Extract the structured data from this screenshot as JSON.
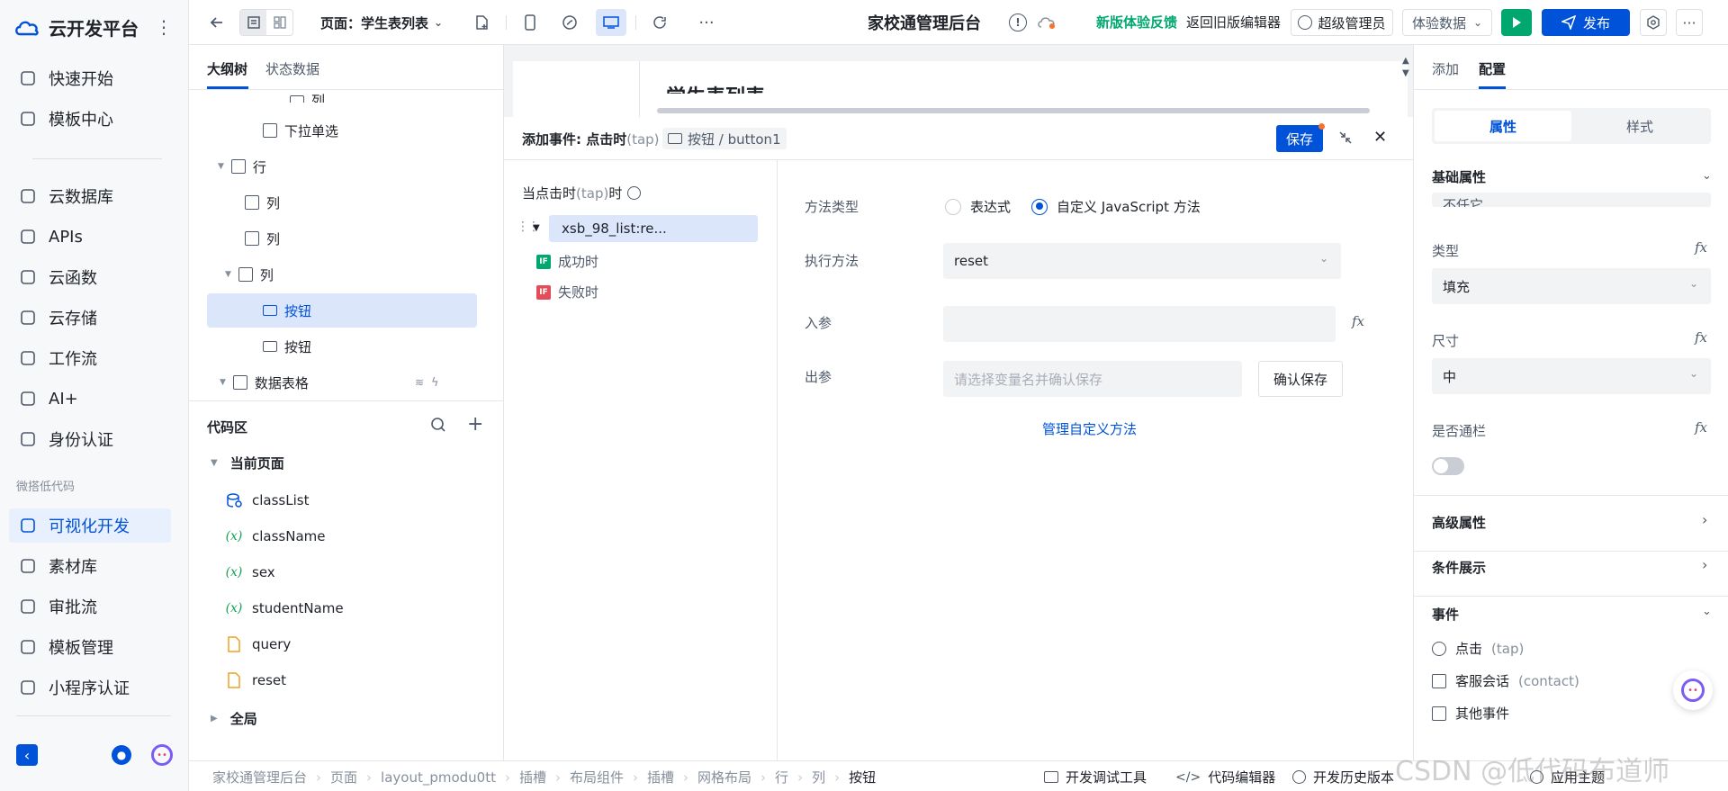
{
  "sidebar": {
    "brand": "云开发平台",
    "items_top": [
      {
        "label": "快速开始",
        "icon": "flag-icon"
      },
      {
        "label": "模板中心",
        "icon": "template-icon"
      }
    ],
    "items_mid": [
      {
        "label": "云数据库",
        "icon": "database-icon"
      },
      {
        "label": "APIs",
        "icon": "link-icon"
      },
      {
        "label": "云函数",
        "icon": "function-icon"
      },
      {
        "label": "云存储",
        "icon": "folder-icon"
      },
      {
        "label": "工作流",
        "icon": "workflow-icon"
      },
      {
        "label": "AI+",
        "icon": "robot-icon"
      },
      {
        "label": "身份认证",
        "icon": "id-card-icon"
      }
    ],
    "group_label": "微搭低代码",
    "items_low": [
      {
        "label": "可视化开发",
        "icon": "visual-dev-icon",
        "active": true
      },
      {
        "label": "素材库",
        "icon": "material-icon"
      },
      {
        "label": "审批流",
        "icon": "stamp-icon"
      },
      {
        "label": "模板管理",
        "icon": "template-manage-icon"
      },
      {
        "label": "小程序认证",
        "icon": "miniprogram-icon"
      }
    ]
  },
  "topbar": {
    "page_label": "页面：学生表列表",
    "app_title": "家校通管理后台",
    "feedback": "新版体验反馈",
    "back_old": "返回旧版编辑器",
    "user": "超级管理员",
    "data_mode": "体验数据",
    "publish": "发布"
  },
  "outline": {
    "tabs": [
      "大纲树",
      "状态数据"
    ],
    "rows": [
      {
        "label": "下拉单选",
        "indent": 82,
        "icon": "list-icon"
      },
      {
        "label": "行",
        "indent": 46,
        "icon": "box-icon",
        "caret": true
      },
      {
        "label": "列",
        "indent": 62,
        "icon": "box-icon"
      },
      {
        "label": "列",
        "indent": 62,
        "icon": "box-icon"
      },
      {
        "label": "列",
        "indent": 54,
        "icon": "box-icon",
        "caret": true
      },
      {
        "label": "按钮",
        "indent": 82,
        "icon": "button-icon",
        "selected": true
      },
      {
        "label": "按钮",
        "indent": 82,
        "icon": "button-icon"
      },
      {
        "label": "数据表格",
        "indent": 48,
        "icon": "table-icon",
        "caret": true
      }
    ],
    "partial_top": "列"
  },
  "code": {
    "title": "代码区",
    "current_page": "当前页面",
    "global": "全局",
    "items": [
      {
        "label": "classList",
        "kind": "query"
      },
      {
        "label": "className",
        "kind": "var"
      },
      {
        "label": "sex",
        "kind": "var"
      },
      {
        "label": "studentName",
        "kind": "var"
      },
      {
        "label": "query",
        "kind": "js"
      },
      {
        "label": "reset",
        "kind": "js"
      }
    ]
  },
  "canvas": {
    "partial_heading": "学生表列表"
  },
  "event": {
    "title_prefix": "添加事件: 点击时",
    "title_tap": "(tap)",
    "target": "按钮 / button1",
    "save": "保存",
    "trigger_label": "当点击时",
    "trigger_tap": "(tap)",
    "trigger_suffix": "时",
    "action_node": "xsb_98_list:re...",
    "success": "成功时",
    "fail": "失败时",
    "method_type_label": "方法类型",
    "option_expr": "表达式",
    "option_js": "自定义 JavaScript 方法",
    "exec_label": "执行方法",
    "exec_value": "reset",
    "input_label": "入参",
    "output_label": "出参",
    "output_placeholder": "请选择变量名并确认保存",
    "confirm_save": "确认保存",
    "manage": "管理自定义方法"
  },
  "rpanel": {
    "tabs": [
      "添加",
      "配置"
    ],
    "seg": [
      "属性",
      "样式"
    ],
    "basic": "基础属性",
    "partial_value": "不任它",
    "type_label": "类型",
    "type_value": "填充",
    "size_label": "尺寸",
    "size_value": "中",
    "full_label": "是否通栏",
    "advanced": "高级属性",
    "condition": "条件展示",
    "events": "事件",
    "event_items": [
      {
        "label": "点击",
        "hint": "(tap)",
        "icon": "pointer-icon"
      },
      {
        "label": "客服会话",
        "hint": "(contact)",
        "icon": "calendar-icon"
      },
      {
        "label": "其他事件",
        "hint": "",
        "icon": "calendar-icon"
      }
    ],
    "fx": "fx"
  },
  "bottombar": {
    "crumbs": [
      "家校通管理后台",
      "页面",
      "layout_pmodu0tt",
      "插槽",
      "布局组件",
      "插槽",
      "网格布局",
      "行",
      "列",
      "按钮"
    ],
    "tools": [
      "开发调试工具",
      "代码编辑器",
      "开发历史版本",
      "应用主题"
    ],
    "watermark": "CSDN @低代码布道师"
  },
  "colors": {
    "primary": "#0052d9",
    "green": "#00a870",
    "selected": "#dbe6fb"
  }
}
